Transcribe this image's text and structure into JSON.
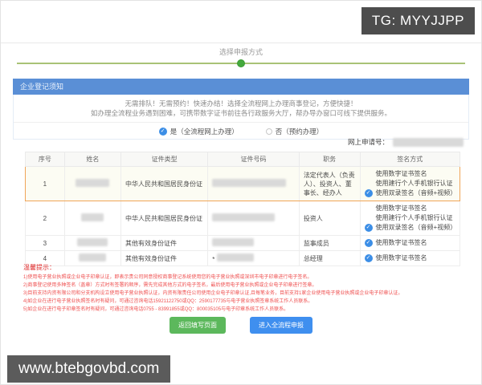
{
  "watermarks": {
    "top_right": "TG: MYYJJPP",
    "bottom_left": "www.btebgovbd.com"
  },
  "stepper": {
    "label": "选择申报方式"
  },
  "panel": {
    "title": "企业登记须知",
    "notice_line1": "无需排队！无需预约！快速办结！选择全流程网上办理商事登记，方便快捷！",
    "notice_line2": "如办理全流程业务遇到困难，可携带数字证书前往各行政服务大厅，帮办导办窗口可线下提供服务。",
    "options": [
      {
        "label": "是（全流程网上办理）",
        "checked": true
      },
      {
        "label": "否（预约办理）",
        "checked": false
      }
    ]
  },
  "application": {
    "label": "网上申请号：",
    "value_redacted": true
  },
  "table": {
    "headers": [
      "序号",
      "姓名",
      "证件类型",
      "证件号码",
      "职务",
      "签名方式"
    ],
    "rows": [
      {
        "no": "1",
        "name_redacted": true,
        "cert_type": "中华人民共和国居民身份证",
        "cert_no_redacted": true,
        "duty": "法定代表人（负责人）、投资人、董事长、经办人",
        "sign_options": [
          {
            "label": "使用数字证书签名",
            "checked": false
          },
          {
            "label": "使用建行个人手机银行认证",
            "checked": false
          },
          {
            "label": "使用双录签名（音频+视频）",
            "checked": true
          }
        ]
      },
      {
        "no": "2",
        "name_redacted": true,
        "cert_type": "中华人民共和国居民身份证",
        "cert_no_redacted": true,
        "duty": "投资人",
        "sign_options": [
          {
            "label": "使用数字证书签名",
            "checked": false
          },
          {
            "label": "使用建行个人手机银行认证",
            "checked": false
          },
          {
            "label": "使用双录签名（音频+视频）",
            "checked": true
          }
        ]
      },
      {
        "no": "3",
        "name_redacted": true,
        "cert_type": "其他有效身份证件",
        "cert_no_redacted": true,
        "duty": "监事成员",
        "sign_options": [
          {
            "label": "使用数字证书签名",
            "checked": true
          }
        ]
      },
      {
        "no": "4",
        "name_redacted": true,
        "cert_type": "其他有效身份证件",
        "cert_prefix": "*",
        "cert_no_redacted": true,
        "duty": "总经理",
        "sign_options": [
          {
            "label": "使用数字证书签名",
            "checked": true
          }
        ]
      }
    ]
  },
  "warning": {
    "title": "温馨提示：",
    "lines": [
      "1)使用电子营业执照或企业电子印章认证，即表示贵公司同意授权商事登记系统使用您的电子营业执照或深圳市电子印章进行电子签名。",
      "2)商事登记使用多种签名（盖章）方式时有签署的顺序，需先完成其他方式的电子签名，最后使用电子营业执照或企业电子印章进行签章。",
      "3)目前支持内资有限公司和分支机构设立使用电子营业执照认证，内资有限责任公司使用企业电子印章认证,且每笔业务，目前支持1家企业使用电子营业执照或企业电子印章认证。",
      "4)如企业在进行电子营业执照签名时有疑问，可通过咨询电话15921122750或QQ：2590177735与电子营业执照签章系统工作人员联系。",
      "5)如企业在进行电子印章签名时有疑问，可通过咨询电话0755 - 83991855或QQ：800035105与电子印章系统工作人员联系。"
    ]
  },
  "buttons": {
    "back": "返回填写页面",
    "submit": "进入全流程申报"
  },
  "colors": {
    "header_blue": "#5a8fd6",
    "check_blue": "#3c8ee6",
    "step_green": "#44a93c",
    "button_green": "#5cb85c",
    "button_blue": "#3f8fef",
    "warning_red": "#ef4f4f",
    "highlight_border": "#f0a558"
  }
}
